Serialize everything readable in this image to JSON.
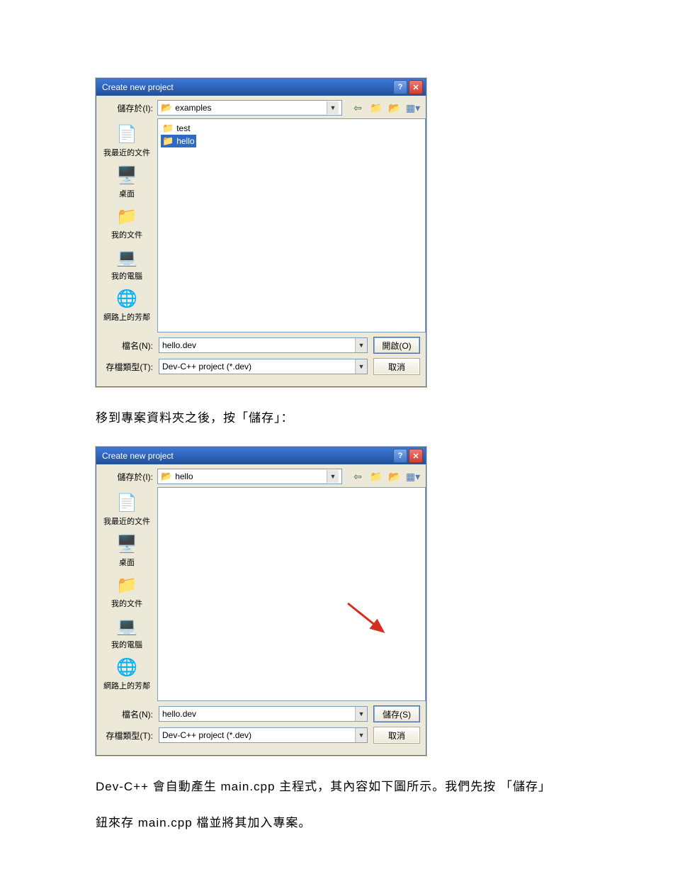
{
  "dialog1": {
    "title": "Create new project",
    "saveInLabel": "儲存於(I):",
    "folderName": "examples",
    "files": [
      {
        "name": "test",
        "selected": false
      },
      {
        "name": "hello",
        "selected": true
      }
    ],
    "filenameLabel": "檔名(N):",
    "filenameValue": "hello.dev",
    "filetypeLabel": "存檔類型(T):",
    "filetypeValue": "Dev-C++ project (*.dev)",
    "primaryBtn": "開啟(O)",
    "cancelBtn": "取消"
  },
  "dialog2": {
    "title": "Create new project",
    "saveInLabel": "儲存於(I):",
    "folderName": "hello",
    "filenameLabel": "檔名(N):",
    "filenameValue": "hello.dev",
    "filetypeLabel": "存檔類型(T):",
    "filetypeValue": "Dev-C++ project (*.dev)",
    "primaryBtn": "儲存(S)",
    "cancelBtn": "取消"
  },
  "sidebar": {
    "items": [
      {
        "label": "我最近的文件"
      },
      {
        "label": "桌面"
      },
      {
        "label": "我的文件"
      },
      {
        "label": "我的電腦"
      },
      {
        "label": "網路上的芳鄰"
      }
    ]
  },
  "para1": "移到專案資料夾之後，按「儲存」：",
  "para2": "Dev-C++ 會自動產生 main.cpp 主程式，其內容如下圖所示。我們先按 「儲存」",
  "para3": "鈕來存 main.cpp 檔並將其加入專案。"
}
